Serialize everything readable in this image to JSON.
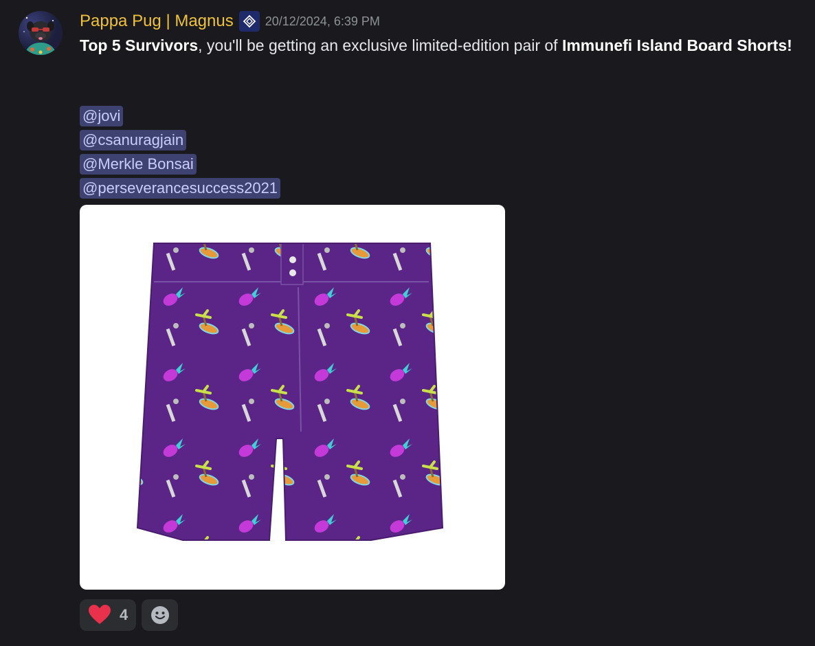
{
  "message": {
    "author": "Pappa Pug | Magnus",
    "timestamp": "20/12/2024, 6:39 PM",
    "content": {
      "bold_1": "Top 5 Survivors",
      "text_1": ", you'll be getting an exclusive limited-edition pair of ",
      "bold_2": "Immunefi Island Board Shorts!"
    },
    "mentions": [
      "@jovi",
      "@csanuragjain",
      "@Merkle Bonsai",
      "@perseverancesuccess2021"
    ],
    "reactions": [
      {
        "emoji": "heart-icon",
        "count": "4"
      }
    ]
  },
  "colors": {
    "background": "#1a1a1e",
    "username": "#f0c23b",
    "mention_bg": "#3e4270",
    "mention_text": "#c9cdfb",
    "shorts": "#5a2586"
  }
}
